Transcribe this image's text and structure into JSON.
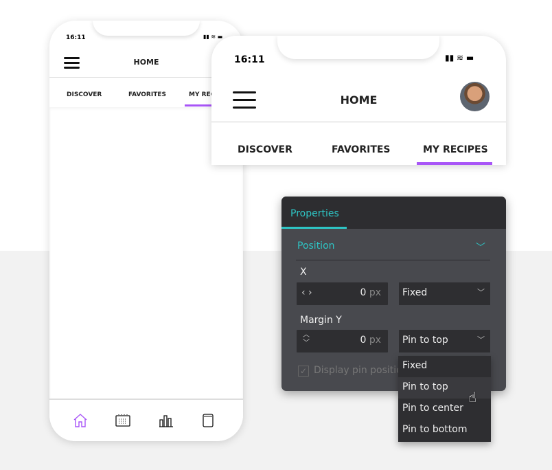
{
  "phone_small": {
    "time": "16:11",
    "status": "▮▮ ≋ ▬",
    "title": "HOME",
    "tabs": [
      "DISCOVER",
      "FAVORITES",
      "MY RECIPES"
    ],
    "active_tab": "MY RECIPES",
    "nav": [
      "home-icon",
      "calendar-icon",
      "chart-icon",
      "book-icon"
    ]
  },
  "phone_large": {
    "time": "16:11",
    "status": "▮▮ ≋ ▬",
    "title": "HOME",
    "tabs": [
      "DISCOVER",
      "FAVORITES",
      "MY RECIPES"
    ],
    "active_tab": "MY RECIPES"
  },
  "panel": {
    "tab": "Properties",
    "section": "Position",
    "x_label": "X",
    "x_value": "0",
    "x_unit": "px",
    "x_mode": "Fixed",
    "margin_label": "Margin Y",
    "margin_value": "0",
    "margin_unit": "px",
    "margin_mode": "Pin to top",
    "checkbox_label": "Display pin position",
    "checkbox_checked": true
  },
  "dropdown": {
    "options": [
      "Fixed",
      "Pin to top",
      "Pin to center",
      "Pin to bottom"
    ],
    "highlighted": "Pin to top"
  },
  "colors": {
    "accent_purple": "#a855f7",
    "accent_teal": "#2ec4c4",
    "panel_bg": "#48494e"
  }
}
